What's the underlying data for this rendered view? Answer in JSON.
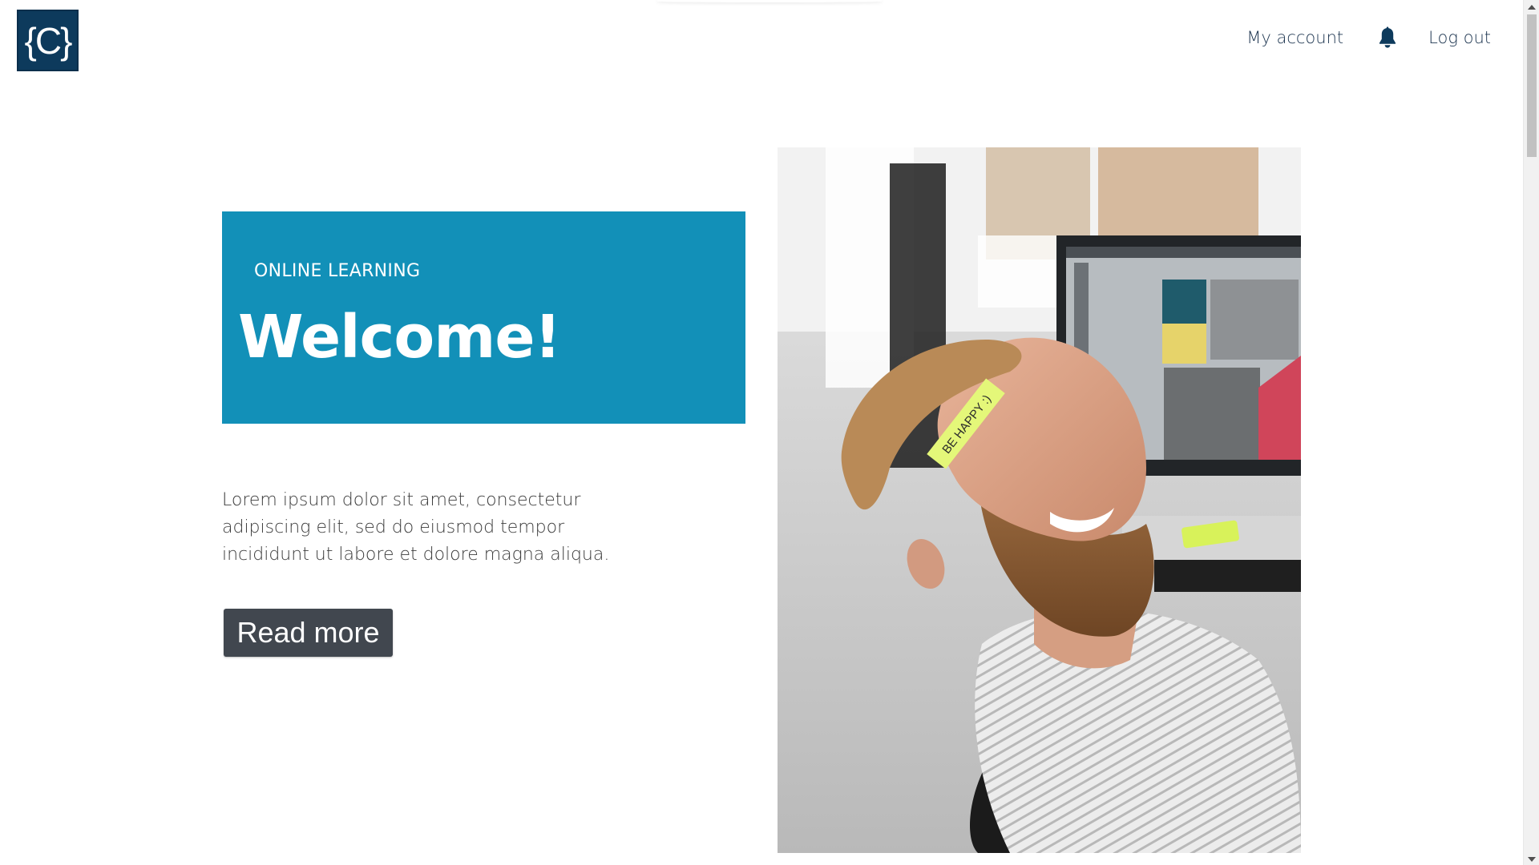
{
  "header": {
    "logo_text": "{C}",
    "nav": {
      "my_account": "My account",
      "notifications_icon": "bell-icon",
      "log_out": "Log out"
    }
  },
  "hero": {
    "eyebrow": "ONLINE LEARNING",
    "title": "Welcome!",
    "lead": "Lorem ipsum dolor sit amet, consectetur adipiscing elit, sed do eiusmod tempor incididunt ut labore et dolore magna aliqua.",
    "cta_label": "Read more",
    "photo_note": "BE HAPPY :)"
  },
  "colors": {
    "brand_navy": "#0d3a5c",
    "hero_blue": "#1290b8",
    "button_gray": "#41474f",
    "nav_text": "#1d3550"
  }
}
